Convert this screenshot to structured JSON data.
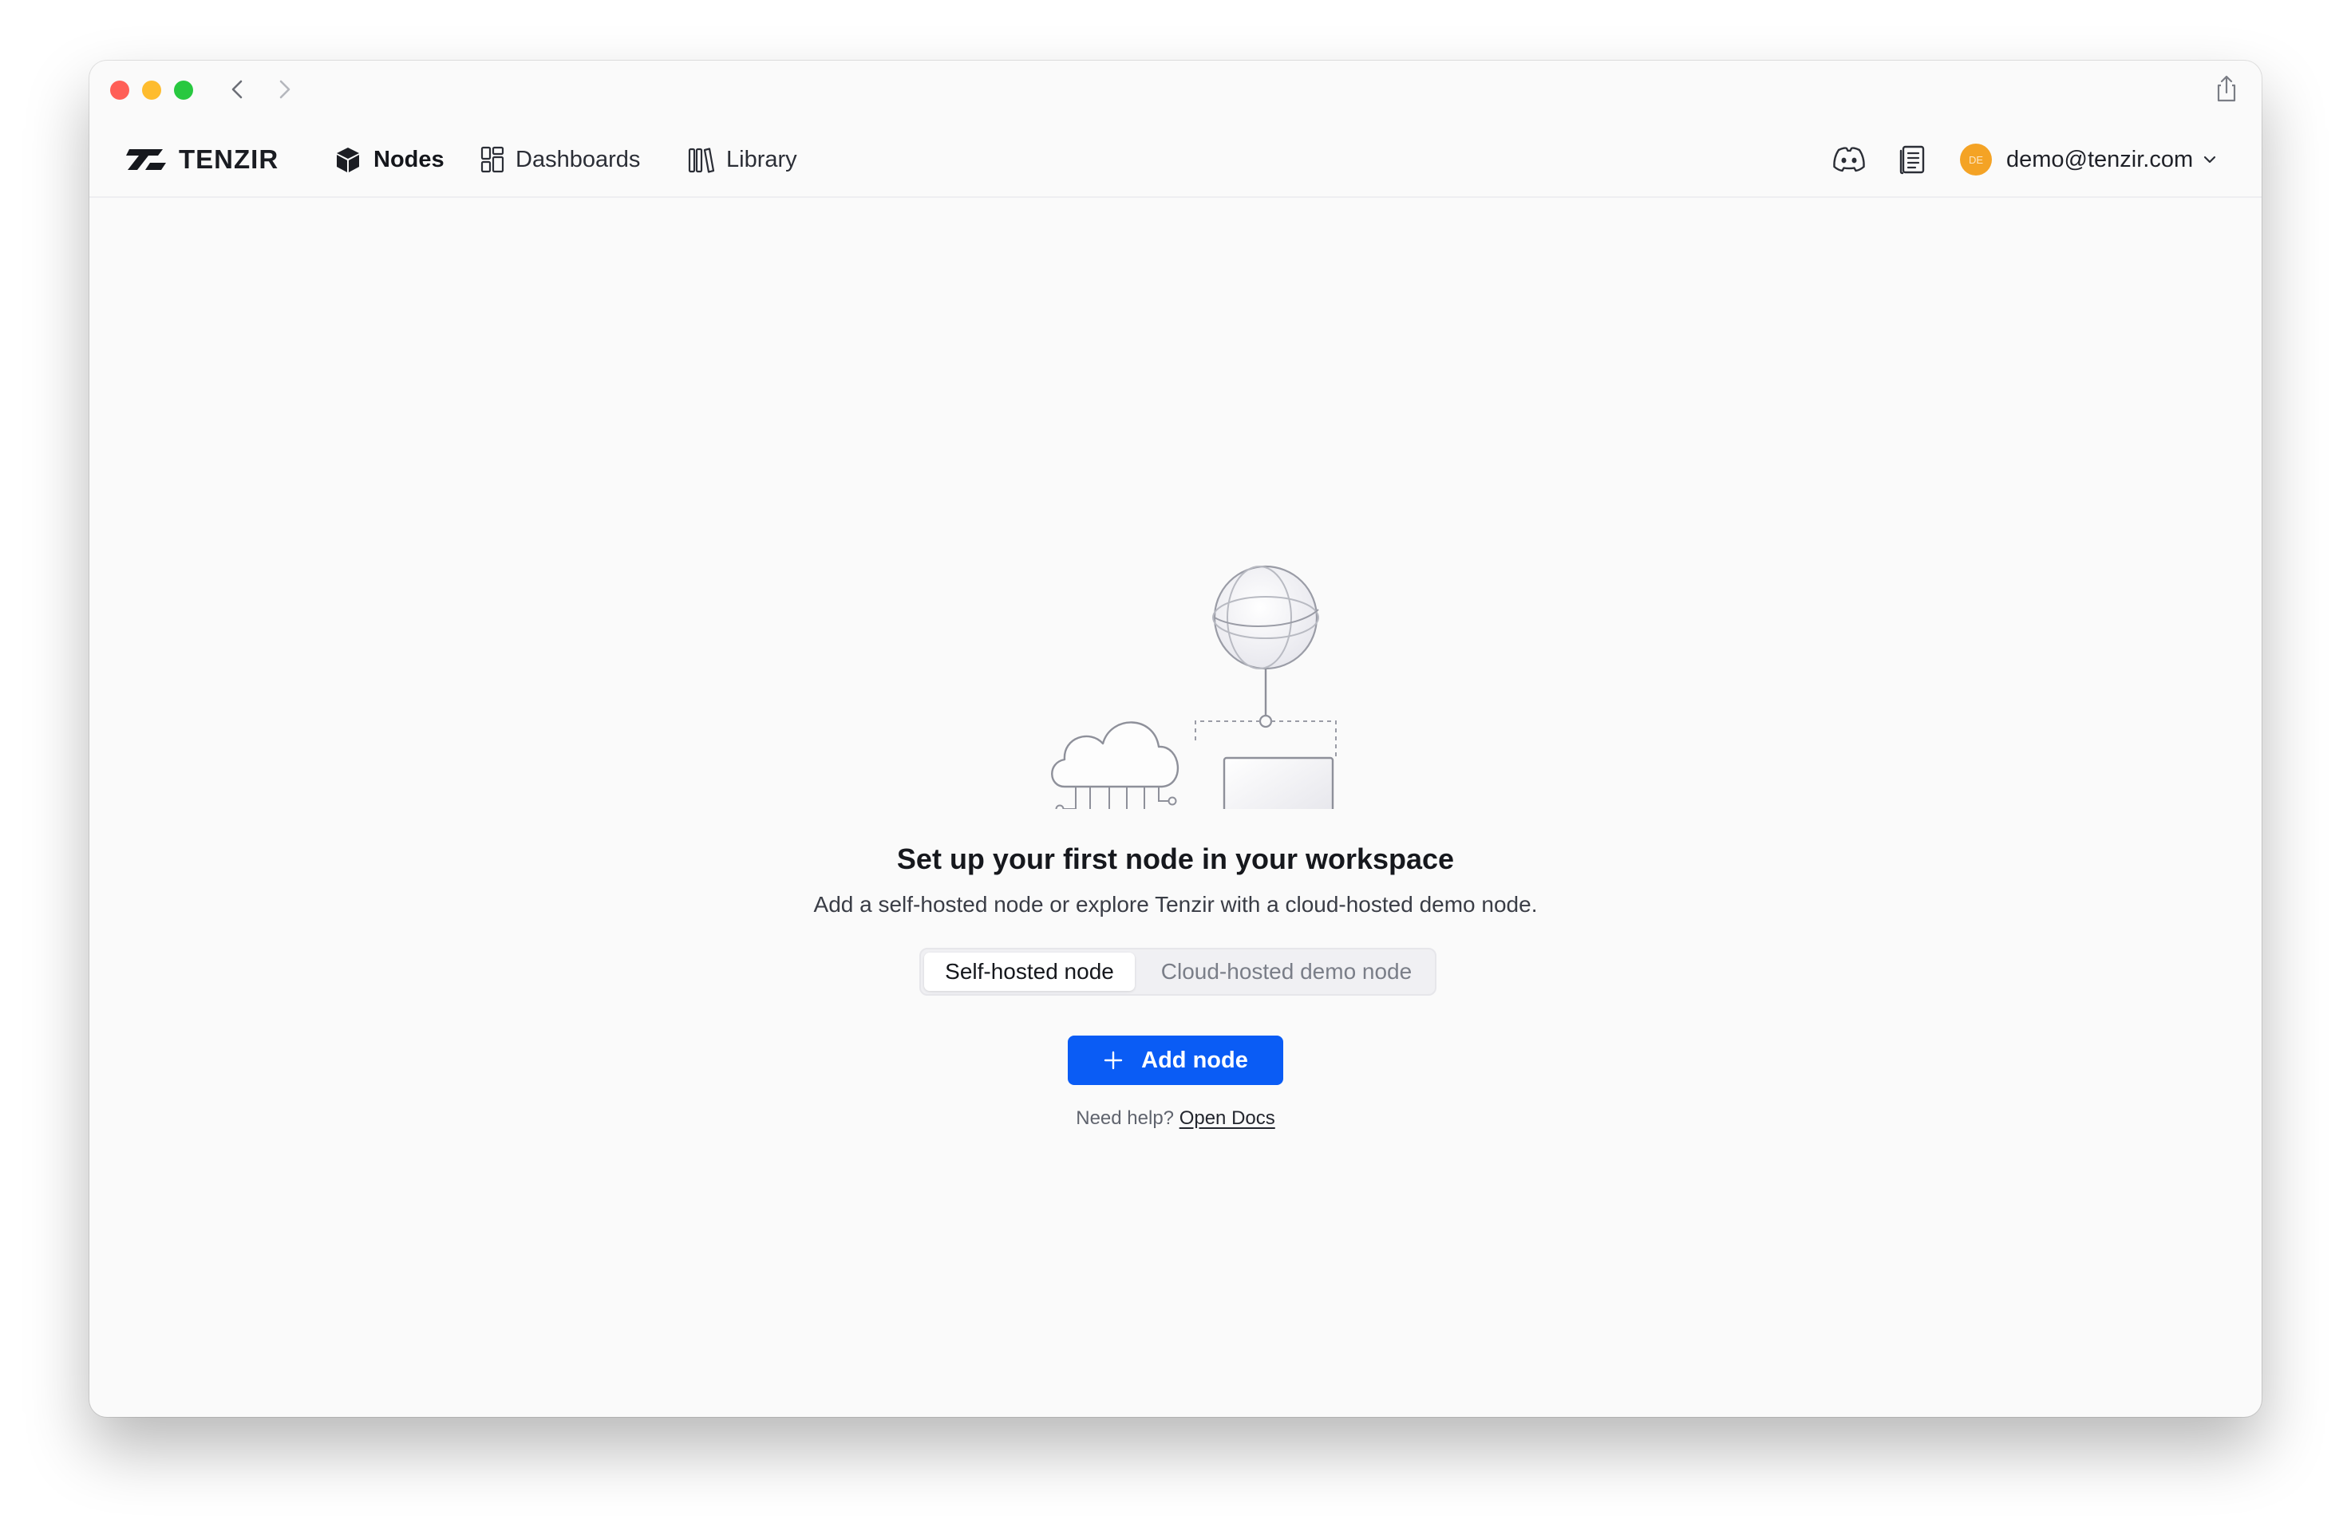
{
  "browser": {
    "traffic_lights": [
      "close",
      "minimize",
      "zoom"
    ],
    "icons": {
      "back": "chevron-left-icon",
      "forward": "chevron-right-icon",
      "share": "share-icon"
    }
  },
  "header": {
    "logo_text": "TENZIR",
    "nav": [
      {
        "label": "Nodes",
        "icon": "cube-icon",
        "active": true
      },
      {
        "label": "Dashboards",
        "icon": "dashboard-icon",
        "active": false
      },
      {
        "label": "Library",
        "icon": "library-icon",
        "active": false
      }
    ],
    "right_icons": [
      "discord-icon",
      "docs-icon"
    ],
    "user": {
      "avatar_initials": "DE",
      "email": "demo@tenzir.com"
    }
  },
  "empty_state": {
    "title": "Set up your first node in your workspace",
    "subtitle": "Add a self-hosted node or explore Tenzir with a cloud-hosted demo node.",
    "tabs": [
      {
        "label": "Self-hosted node",
        "selected": true
      },
      {
        "label": "Cloud-hosted demo node",
        "selected": false
      }
    ],
    "add_button": "Add node",
    "help_prefix": "Need help?",
    "help_link": "Open Docs"
  },
  "colors": {
    "primary": "#0a5cf5",
    "avatar": "#f4a325",
    "close": "#ff5f57",
    "minimize": "#febc2e",
    "zoom": "#28c840"
  }
}
